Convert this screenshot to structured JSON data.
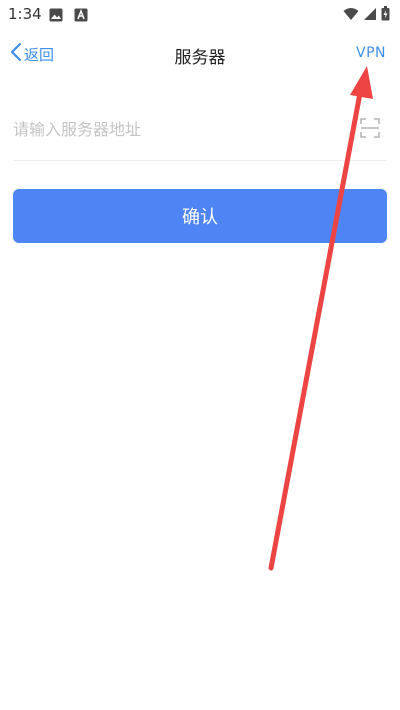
{
  "status_bar": {
    "time": "1:34"
  },
  "nav": {
    "back_label": "返回",
    "title": "服务器",
    "vpn_label": "VPN"
  },
  "server_input": {
    "placeholder": "请输入服务器地址",
    "value": ""
  },
  "confirm_label": "确认",
  "colors": {
    "accent": "#3d8fe6",
    "button": "#4f84f5",
    "annotation": "#ef4444"
  },
  "icons": {
    "back": "chevron-left-icon",
    "scan": "scan-icon",
    "status": [
      "image-icon",
      "a-icon",
      "wifi-icon",
      "signal-icon",
      "battery-icon"
    ]
  }
}
